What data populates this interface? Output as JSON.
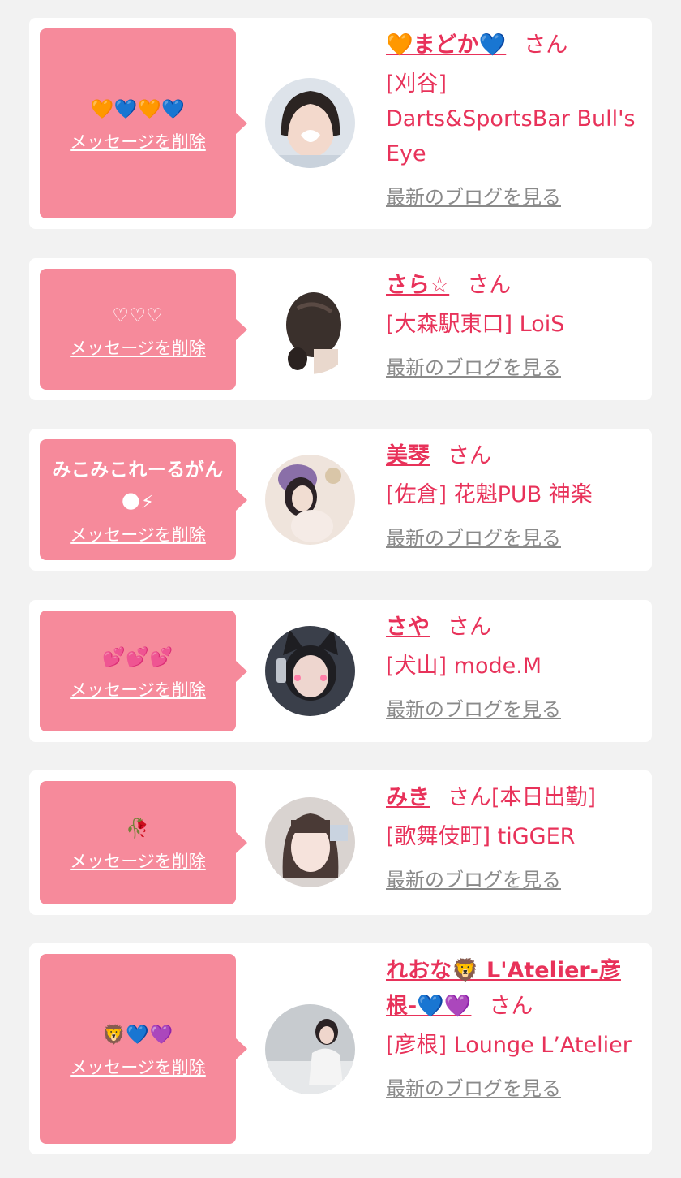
{
  "colors": {
    "accent": "#e8325a",
    "bubble": "#f68a9b",
    "background": "#f2f2f2"
  },
  "items": [
    {
      "message": "🧡💙🧡💙",
      "delete_label": "メッセージを削除",
      "name": "🧡まどか💙",
      "honorific": "さん",
      "shop": "[刈谷] Darts&SportsBar Bull's Eye",
      "blog_label": "最新のブログを見る"
    },
    {
      "message": "♡♡♡",
      "delete_label": "メッセージを削除",
      "name": "さら☆",
      "honorific": "さん",
      "shop": "[大森駅東口] LoiS",
      "blog_label": "最新のブログを見る"
    },
    {
      "message": "みこみこれーるがん🌑⚡",
      "delete_label": "メッセージを削除",
      "name": "美琴",
      "honorific": "さん",
      "shop": "[佐倉] 花魁PUB 神楽",
      "blog_label": "最新のブログを見る"
    },
    {
      "message": "💕💕💕",
      "delete_label": "メッセージを削除",
      "name": "さや",
      "honorific": "さん",
      "shop": "[犬山] mode.M",
      "blog_label": "最新のブログを見る"
    },
    {
      "message": "🥀",
      "delete_label": "メッセージを削除",
      "name": "みき",
      "honorific": "さん[本日出勤]",
      "shop": "[歌舞伎町] tiGGER",
      "blog_label": "最新のブログを見る"
    },
    {
      "message": "🦁💙💜",
      "delete_label": "メッセージを削除",
      "name": "れおな🦁 L'Atelier-彦根-💙💜",
      "honorific": "さん",
      "shop": "[彦根] Lounge L’Atelier",
      "blog_label": "最新のブログを見る"
    }
  ]
}
